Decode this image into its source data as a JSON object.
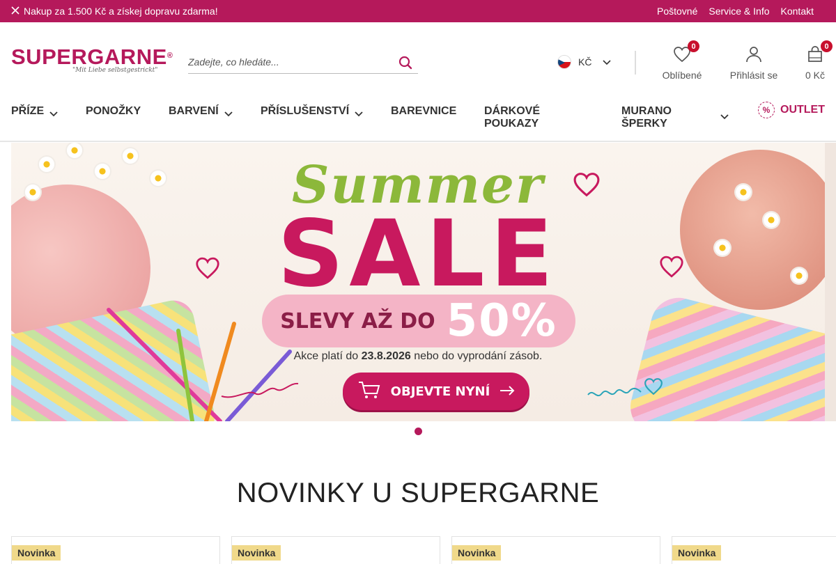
{
  "topbar": {
    "promo": "Nakup za 1.500 Kč a získej dopravu zdarma!",
    "links": [
      "Poštovné",
      "Service & Info",
      "Kontakt"
    ]
  },
  "header": {
    "logo_text": "SUPERGARNE",
    "logo_mark": "®",
    "logo_tagline": "\"Mit Liebe selbstgestrickt\"",
    "search_placeholder": "Zadejte, co hledáte...",
    "currency": "KČ",
    "favorites_label": "Oblíbené",
    "favorites_count": "0",
    "login_label": "Přihlásit se",
    "cart_label": "0 Kč",
    "cart_count": "0"
  },
  "nav": {
    "items": [
      {
        "label": "PŘÍZE",
        "has_dropdown": true
      },
      {
        "label": "PONOŽKY",
        "has_dropdown": false
      },
      {
        "label": "BARVENÍ",
        "has_dropdown": true
      },
      {
        "label": "PŘÍSLUŠENSTVÍ",
        "has_dropdown": true
      },
      {
        "label": "BAREVNICE",
        "has_dropdown": false
      },
      {
        "label": "DÁRKOVÉ POUKAZY",
        "has_dropdown": false
      },
      {
        "label": "MURANO ŠPERKY",
        "has_dropdown": true
      }
    ],
    "outlet_label": "OUTLET",
    "outlet_icon_text": "%"
  },
  "banner": {
    "script_title": "Summer",
    "headline": "SALE",
    "discount_prefix": "SLEVY AŽ DO",
    "discount_value": "50%",
    "note_prefix": "Akce platí do",
    "note_date": "23.8.2026",
    "note_suffix": "nebo do vyprodání zásob.",
    "cta_label": "OBJEVTE NYNÍ",
    "slides": 1,
    "active_slide": 1
  },
  "section": {
    "title": "NOVINKY U SUPERGARNE"
  },
  "products": [
    {
      "tag": "Novinka"
    },
    {
      "tag": "Novinka"
    },
    {
      "tag": "Novinka"
    },
    {
      "tag": "Novinka"
    }
  ],
  "colors": {
    "brand": "#b5195b",
    "sale_pink": "#c8195e",
    "summer_green": "#8cb83a",
    "badge_red": "#c8102e",
    "novinka_tag": "#f0d98a"
  }
}
